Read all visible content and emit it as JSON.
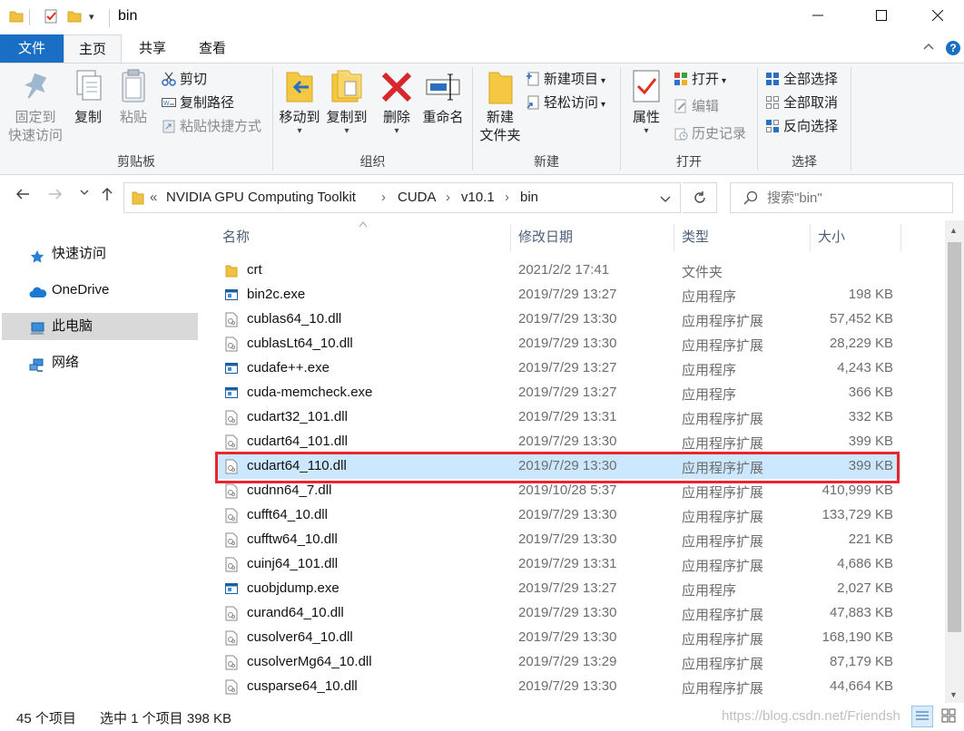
{
  "window": {
    "title": "bin",
    "minimize_icon": "minimize-icon",
    "maximize_icon": "maximize-icon",
    "close_icon": "close-icon"
  },
  "ribbon_tabs": [
    {
      "label": "文件"
    },
    {
      "label": "主页"
    },
    {
      "label": "共享"
    },
    {
      "label": "查看"
    }
  ],
  "ribbon": {
    "clipboard": {
      "pin_label": "固定到\n快速访问",
      "pin_line1": "固定到",
      "pin_line2": "快速访问",
      "copy_label": "复制",
      "paste_label": "粘贴",
      "cut_label": "剪切",
      "copy_path_label": "复制路径",
      "paste_shortcut_label": "粘贴快捷方式",
      "group_label": "剪贴板"
    },
    "organize": {
      "move_to_label": "移动到",
      "copy_to_label": "复制到",
      "delete_label": "删除",
      "rename_label": "重命名",
      "group_label": "组织"
    },
    "new": {
      "new_folder_line1": "新建",
      "new_folder_line2": "文件夹",
      "new_item_label": "新建项目",
      "easy_access_label": "轻松访问",
      "group_label": "新建"
    },
    "open": {
      "properties_label": "属性",
      "open_label": "打开",
      "edit_label": "编辑",
      "history_label": "历史记录",
      "group_label": "打开"
    },
    "select": {
      "select_all_label": "全部选择",
      "select_none_label": "全部取消",
      "invert_label": "反向选择",
      "group_label": "选择"
    }
  },
  "address": {
    "prefix": "«",
    "crumbs": [
      "NVIDIA GPU Computing Toolkit",
      "CUDA",
      "v10.1",
      "bin"
    ],
    "separator": "›",
    "search_placeholder": "搜索\"bin\""
  },
  "nav": [
    {
      "label": "快速访问",
      "icon": "star-icon"
    },
    {
      "label": "OneDrive",
      "icon": "cloud-icon"
    },
    {
      "label": "此电脑",
      "icon": "computer-icon",
      "selected": true
    },
    {
      "label": "网络",
      "icon": "network-icon"
    }
  ],
  "columns": {
    "name": "名称",
    "date": "修改日期",
    "type": "类型",
    "size": "大小"
  },
  "files": [
    {
      "name": "crt",
      "date": "2021/2/2 17:41",
      "type": "文件夹",
      "size": "",
      "kind": "folder"
    },
    {
      "name": "bin2c.exe",
      "date": "2019/7/29 13:27",
      "type": "应用程序",
      "size": "198 KB",
      "kind": "exe"
    },
    {
      "name": "cublas64_10.dll",
      "date": "2019/7/29 13:30",
      "type": "应用程序扩展",
      "size": "57,452 KB",
      "kind": "dll"
    },
    {
      "name": "cublasLt64_10.dll",
      "date": "2019/7/29 13:30",
      "type": "应用程序扩展",
      "size": "28,229 KB",
      "kind": "dll"
    },
    {
      "name": "cudafe++.exe",
      "date": "2019/7/29 13:27",
      "type": "应用程序",
      "size": "4,243 KB",
      "kind": "exe"
    },
    {
      "name": "cuda-memcheck.exe",
      "date": "2019/7/29 13:27",
      "type": "应用程序",
      "size": "366 KB",
      "kind": "exe"
    },
    {
      "name": "cudart32_101.dll",
      "date": "2019/7/29 13:31",
      "type": "应用程序扩展",
      "size": "332 KB",
      "kind": "dll"
    },
    {
      "name": "cudart64_101.dll",
      "date": "2019/7/29 13:30",
      "type": "应用程序扩展",
      "size": "399 KB",
      "kind": "dll"
    },
    {
      "name": "cudart64_110.dll",
      "date": "2019/7/29 13:30",
      "type": "应用程序扩展",
      "size": "399 KB",
      "kind": "dll",
      "selected": true
    },
    {
      "name": "cudnn64_7.dll",
      "date": "2019/10/28 5:37",
      "type": "应用程序扩展",
      "size": "410,999 KB",
      "kind": "dll"
    },
    {
      "name": "cufft64_10.dll",
      "date": "2019/7/29 13:30",
      "type": "应用程序扩展",
      "size": "133,729 KB",
      "kind": "dll"
    },
    {
      "name": "cufftw64_10.dll",
      "date": "2019/7/29 13:30",
      "type": "应用程序扩展",
      "size": "221 KB",
      "kind": "dll"
    },
    {
      "name": "cuinj64_101.dll",
      "date": "2019/7/29 13:31",
      "type": "应用程序扩展",
      "size": "4,686 KB",
      "kind": "dll"
    },
    {
      "name": "cuobjdump.exe",
      "date": "2019/7/29 13:27",
      "type": "应用程序",
      "size": "2,027 KB",
      "kind": "exe"
    },
    {
      "name": "curand64_10.dll",
      "date": "2019/7/29 13:30",
      "type": "应用程序扩展",
      "size": "47,883 KB",
      "kind": "dll"
    },
    {
      "name": "cusolver64_10.dll",
      "date": "2019/7/29 13:30",
      "type": "应用程序扩展",
      "size": "168,190 KB",
      "kind": "dll"
    },
    {
      "name": "cusolverMg64_10.dll",
      "date": "2019/7/29 13:29",
      "type": "应用程序扩展",
      "size": "87,179 KB",
      "kind": "dll"
    },
    {
      "name": "cusparse64_10.dll",
      "date": "2019/7/29 13:30",
      "type": "应用程序扩展",
      "size": "44,664 KB",
      "kind": "dll"
    }
  ],
  "status": {
    "count": "45 个项目",
    "selection": "选中 1 个项目  398 KB",
    "watermark": "https://blog.csdn.net/Friendsh"
  },
  "colors": {
    "accent": "#1a6fc4",
    "selection": "#cce8ff",
    "highlight_border": "#e8262c"
  }
}
